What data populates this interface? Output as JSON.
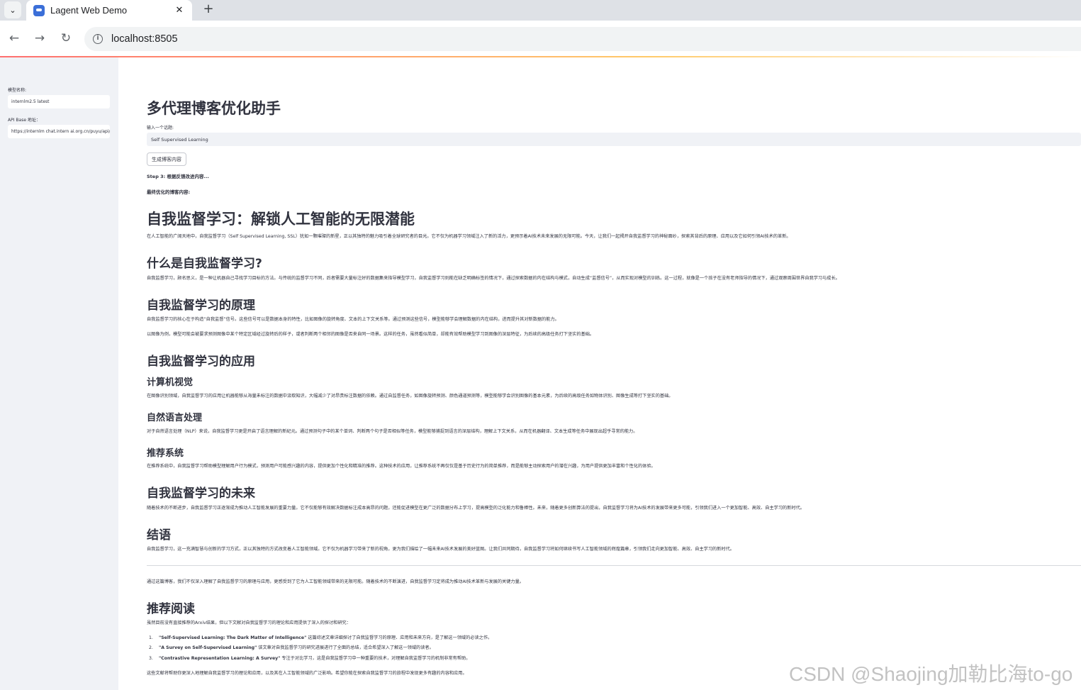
{
  "browser": {
    "tab_title": "Lagent Web Demo",
    "tab_close": "✕",
    "new_tab": "+",
    "url": "localhost:8505"
  },
  "sidebar": {
    "model_label": "模型名称:",
    "model_value": "internlm2.5 latest",
    "api_label": "API Base 地址：",
    "api_value": "https://internlm chat.intern ai.org.cn/puyu/api/v1/"
  },
  "main": {
    "page_title": "多代理博客优化助手",
    "topic_label": "输入一个话题:",
    "topic_value": "Self Supervised Learning",
    "generate_button": "生成博客内容",
    "step_text": "Step 3: 根据反馈改进内容...",
    "final_label": "最终优化的博客内容:"
  },
  "blog": {
    "title": "自我监督学习：解锁人工智能的无限潜能",
    "intro": "在人工智能的广阔天地中，自我监督学习（Self Supervised Learning, SSL）犹如一颗璀璨的新星，正以其独特的魅力吸引着全球研究者的目光。它不仅为机器学习领域注入了新的活力，更预示着AI技术未来发展的无限可能。今天，让我们一起揭开自我监督学习的神秘面纱，探索其背后的原理、应用以及它如何引领AI技术的革新。",
    "s1_title": "什么是自我监督学习?",
    "s1_p": "自我监督学习，顾名思义，是一种让机器自己寻找学习目标的方法。与传统的监督学习不同，后者需要大量标注好的数据集来指导模型学习，自我监督学习则能在缺乏明确标签的情况下，通过探索数据的内在结构与模式，自动生成“监督信号”，从而实现对模型的训练。这一过程，就像是一个孩子在没有老师指导的情况下，通过观察周围世界自我学习与成长。",
    "s2_title": "自我监督学习的原理",
    "s2_p1": "自我监督学习的核心在于构造“自我监督”信号。这些信号可以是数据本身的特性，比如图像的旋转角度、文本的上下文关系等。通过预测这些信号，模型能够学会理解数据的内在结构，进而提升其对新数据的能力。",
    "s2_p2": "以图像为例，模型可能会被要求预测图像中某个特定区域经过旋转后的样子，或者判断两个相邻的图像是否来自同一场景。这样的任务，虽然看似简单，却能有效帮助模型学习到图像的深层特征，为后续的高级任务打下坚实的基础。",
    "s3_title": "自我监督学习的应用",
    "s3a_title": "计算机视觉",
    "s3a_p": "在图像识别领域，自我监督学习的应用让机器能够从海量未标注的数据中汲取知识，大幅减少了对昂贵标注数据的依赖。通过自监督任务，如图像旋转预测、颜色通道预测等，模型能够学会识别图像的基本元素，为后续的高级任务如物体识别、图像生成等打下坚实的基础。",
    "s3b_title": "自然语言处理",
    "s3b_p": "对于自然语言处理（NLP）来说，自我监督学习更是开启了语言理解的新纪元。通过预测句子中的某个单词、判断两个句子是否相似等任务，模型能够捕捉到语言的深层结构，理解上下文关系，从而在机器翻译、文本生成等任务中展现出超乎寻常的能力。",
    "s3c_title": "推荐系统",
    "s3c_p": "在推荐系统中，自我监督学习帮助模型理解用户行为模式，预测用户可能感兴趣的内容，提供更加个性化和精准的推荐。这种技术的应用，让推荐系统不再仅仅是基于历史行为的简单推荐，而是能够主动探索用户的潜在兴趣，为用户提供更加丰富和个性化的体验。",
    "s4_title": "自我监督学习的未来",
    "s4_p": "随着技术的不断进步，自我监督学习正逐渐成为推动人工智能发展的重要力量。它不仅能够有效解决数据标注成本高昂的问题，还能促进模型在更广泛的数据分布上学习，提高模型的泛化能力和鲁棒性。未来，随着更多创新算法的提出，自我监督学习将为AI技术的发展带来更多可能，引领我们进入一个更加智能、高效、自主学习的新时代。",
    "s5_title": "结语",
    "s5_p": "自我监督学习，这一充满智慧与创新的学习方式，正以其独特的方式改变着人工智能领域。它不仅为机器学习带来了新的视角，更为我们描绘了一幅未来AI技术发展的美好蓝图。让我们共同期待，自我监督学习将如何继续书写人工智能领域的辉煌篇章，引领我们走向更加智能、高效、自主学习的新时代。",
    "after_rule": "通过这篇博客，我们不仅深入理解了自我监督学习的原理与应用，更感受到了它为人工智能领域带来的无限可能。随着技术的不断演进，自我监督学习定将成为推动AI技术革新与发展的关键力量。",
    "s6_title": "推荐阅读",
    "s6_intro": "虽然目前没有直接推荐的Arxiv结果，但以下文献对自我监督学习的理论和应用提供了深入的探讨和研究：",
    "refs": [
      {
        "num": "1.",
        "title": "\"Self-Supervised Learning: The Dark Matter of Intelligence\"",
        "desc": " 这篇综述文章详细探讨了自我监督学习的原理、应用和未来方向，是了解这一领域的必读之作。"
      },
      {
        "num": "2.",
        "title": "\"A Survey on Self-Supervised Learning\"",
        "desc": " 该文章对自我监督学习的研究进展进行了全面的总结，适合希望深入了解这一领域的读者。"
      },
      {
        "num": "3.",
        "title": "\"Contrastive Representation Learning: A Survey\"",
        "desc": " 专注于对比学习，这是自我监督学习中一种重要的技术，对理解自我监督学习的机制非常有帮助。"
      }
    ],
    "outro": "这些文献将帮助你更深入地理解自我监督学习的理论和应用，以及其在人工智能领域的广泛影响。希望你能在探索自我监督学习的旅程中发现更多有趣的内容和应用。"
  },
  "watermark": "CSDN @Shaojing加勒比海to-go"
}
